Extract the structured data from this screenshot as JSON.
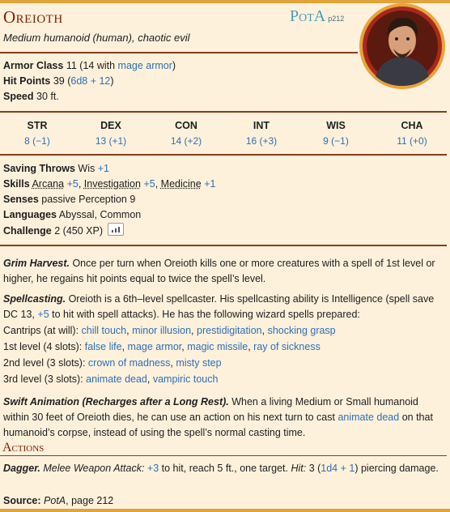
{
  "name": "Oreioth",
  "source": {
    "abbr": "PotA",
    "page": "p212"
  },
  "subtype": "Medium humanoid (human), chaotic evil",
  "armor_class": {
    "label": "Armor Class",
    "value_pre": "11 (14 with ",
    "link": "mage armor",
    "value_post": ")"
  },
  "hit_points": {
    "label": "Hit Points",
    "value_pre": "39 (",
    "link": "6d8 + 12",
    "value_post": ")"
  },
  "speed": {
    "label": "Speed",
    "value": "30 ft."
  },
  "abilities": [
    {
      "key": "STR",
      "value": "8 (−1)"
    },
    {
      "key": "DEX",
      "value": "13 (+1)"
    },
    {
      "key": "CON",
      "value": "14 (+2)"
    },
    {
      "key": "INT",
      "value": "16 (+3)"
    },
    {
      "key": "WIS",
      "value": "9 (−1)"
    },
    {
      "key": "CHA",
      "value": "11 (+0)"
    }
  ],
  "saving_throws": {
    "label": "Saving Throws",
    "text": "Wis ",
    "link": "+1"
  },
  "skills": {
    "label": "Skills",
    "items": [
      {
        "name": "Arcana",
        "bonus": "+5"
      },
      {
        "name": "Investigation",
        "bonus": "+5"
      },
      {
        "name": "Medicine",
        "bonus": "+1"
      }
    ]
  },
  "senses": {
    "label": "Senses",
    "value": "passive Perception 9"
  },
  "languages": {
    "label": "Languages",
    "value": "Abyssal, Common"
  },
  "challenge": {
    "label": "Challenge",
    "value": "2 (450 XP)"
  },
  "traits": {
    "grim_harvest": {
      "title": "Grim Harvest.",
      "text": " Once per turn when Oreioth kills one or more creatures with a spell of 1st level or higher, he regains hit points equal to twice the spell’s level."
    },
    "spellcasting": {
      "title": "Spellcasting.",
      "text_a": " Oreioth is a 6th–level spellcaster. His spellcasting ability is Intelligence (spell save DC 13, ",
      "bonus": "+5",
      "text_b": " to hit with spell attacks). He has the following wizard spells prepared:",
      "cantrips_label": "Cantrips (at will): ",
      "cantrips": [
        "chill touch",
        "minor illusion",
        "prestidigitation",
        "shocking grasp"
      ],
      "l1_label": "1st level (4 slots): ",
      "l1": [
        "false life",
        "mage armor",
        "magic missile",
        "ray of sickness"
      ],
      "l2_label": "2nd level (3 slots): ",
      "l2": [
        "crown of madness",
        "misty step"
      ],
      "l3_label": "3rd level (3 slots): ",
      "l3": [
        "animate dead",
        "vampiric touch"
      ]
    },
    "swift_animation": {
      "title": "Swift Animation (Recharges after a Long Rest).",
      "text_a": " When a living Medium or Small humanoid within 30 feet of Oreioth dies, he can use an action on his next turn to cast ",
      "link": "animate dead",
      "text_b": " on that humanoid’s corpse, instead of using the spell’s normal casting time."
    }
  },
  "actions_header": "Actions",
  "dagger": {
    "title": "Dagger.",
    "type": "Melee Weapon Attack:",
    "bonus": "+3",
    "text_a": " to hit, reach 5 ft., one target. ",
    "hit_label": "Hit:",
    "hit_pre": " 3 (",
    "dice": "1d4 + 1",
    "hit_post": ") piercing damage."
  },
  "source_line": {
    "label": "Source:",
    "book": "PotA",
    "page": ", page 212"
  },
  "colors": {
    "name": "#822000",
    "link": "#2f6fb4",
    "rule": "#8c3a1c",
    "bar": "#e0a43b",
    "bg": "#fdf1dc"
  }
}
